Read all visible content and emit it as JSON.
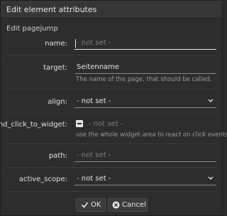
{
  "dialog": {
    "title": "Edit element attributes",
    "subtitle": "Edit pagejump"
  },
  "fields": {
    "name": {
      "label": "name:",
      "placeholder": "- not set -"
    },
    "target": {
      "label": "target:",
      "value": "Seitenname",
      "help": "The name of the page, that should be called."
    },
    "align": {
      "label": "align:",
      "value": "- not set -"
    },
    "bind_click_to_widget": {
      "label": "bind_click_to_widget:",
      "value": "- not set -",
      "help": "use the whole widget area to react on click events"
    },
    "path": {
      "label": "path:",
      "placeholder": "- not set -"
    },
    "active_scope": {
      "label": "active_scope:",
      "value": "- not set -"
    }
  },
  "buttons": {
    "ok": "OK",
    "cancel": "Cancel"
  },
  "icons": {
    "dropdown": "chevron-down-icon",
    "ok": "checkmark-icon",
    "cancel": "cancel-circle-icon",
    "checkbox": "indeterminate-checkbox-icon"
  }
}
